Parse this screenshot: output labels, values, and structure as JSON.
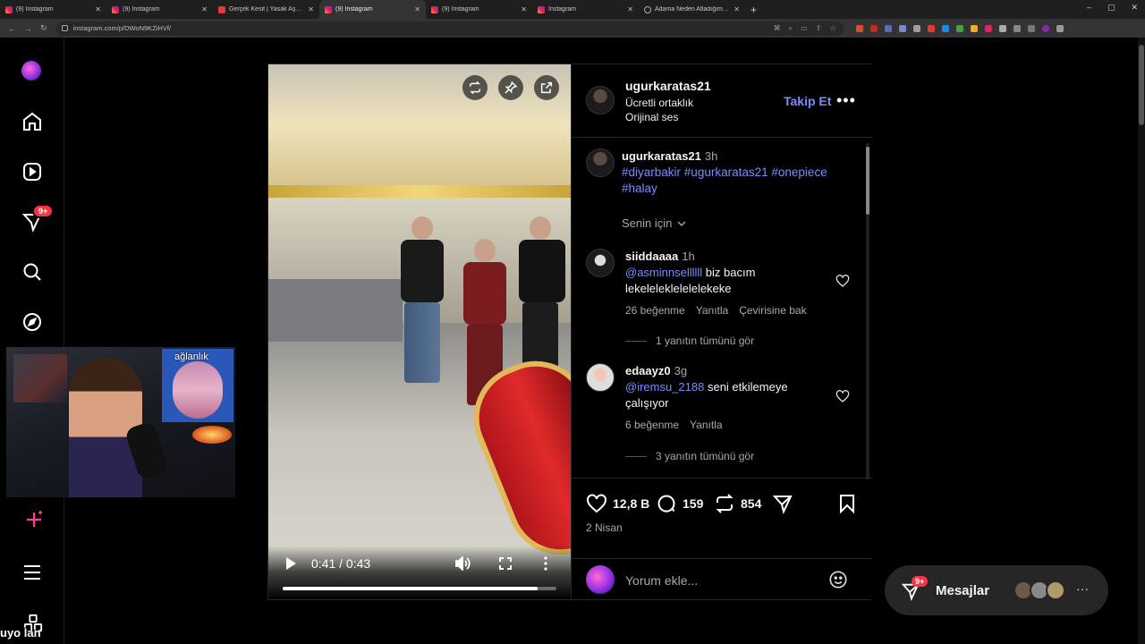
{
  "browser": {
    "tabs": [
      {
        "label": "(9) Instagram",
        "favicon": "instagram-icon",
        "active": false
      },
      {
        "label": "(9) Instagram",
        "favicon": "instagram-icon",
        "active": false
      },
      {
        "label": "Gerçek Kesit | Yasak Aşk - YouTube",
        "favicon": "youtube-icon",
        "active": false
      },
      {
        "label": "(9) Instagram",
        "favicon": "instagram-icon",
        "active": true
      },
      {
        "label": "(9) Instagram",
        "favicon": "instagram-icon",
        "active": false
      },
      {
        "label": "Instagram",
        "favicon": "instagram-icon",
        "active": false
      },
      {
        "label": "Adama Neden Atladığımı Sordu",
        "favicon": "doc-icon",
        "active": false
      }
    ],
    "url": "instagram.com/p/DWoN9KZiHVf/",
    "window_controls": [
      "–",
      "▢",
      "✕"
    ]
  },
  "sidenav": {
    "notifications_badge": "9+",
    "items": [
      "home-icon",
      "reels-icon",
      "messages-icon",
      "search-icon",
      "explore-icon",
      "create-icon",
      "more-menu-icon",
      "meta-icon"
    ]
  },
  "overlay": {
    "webcam_inset_label": "ağlanlık",
    "streamer_name": "uyo lan"
  },
  "video": {
    "current_time": "0:41",
    "separator": "/",
    "duration": "0:43",
    "progress": 0.93
  },
  "post": {
    "username": "ugurkaratas21",
    "subtitle": "Ücretli ortaklık",
    "audio": "Orijinal ses",
    "follow_label": "Takip Et",
    "more": "•••",
    "caption": {
      "username": "ugurkaratas21",
      "time": "3h",
      "hashtags": [
        "#diyarbakir",
        "#ugurkaratas21",
        "#onepiece",
        "#halay"
      ]
    },
    "sort_label": "Senin için",
    "comments": [
      {
        "username": "siiddaaaa",
        "time": "1h",
        "mention": "@asminnsellllll",
        "text": " biz bacım lekeleleklelelelekeke",
        "likes": "26 beğenme",
        "reply": "Yanıtla",
        "translate": "Çevirisine bak",
        "view_replies": "1 yanıtın tümünü gör"
      },
      {
        "username": "edaayz0",
        "time": "3g",
        "mention": "@iremsu_2188",
        "text": " seni etkilemeye çalışıyor",
        "likes": "6 beğenme",
        "reply": "Yanıtla",
        "view_replies": "3 yanıtın tümünü gör"
      }
    ],
    "likes_count": "12,8 B",
    "comments_count": "159",
    "reposts_count": "854",
    "date": "2 Nisan",
    "comment_placeholder": "Yorum ekle..."
  },
  "messages": {
    "label": "Mesajlar",
    "badge": "9+",
    "more": "···"
  },
  "colors": {
    "accent": "#7c8cff",
    "badge": "#ff3040",
    "background": "#000000"
  }
}
